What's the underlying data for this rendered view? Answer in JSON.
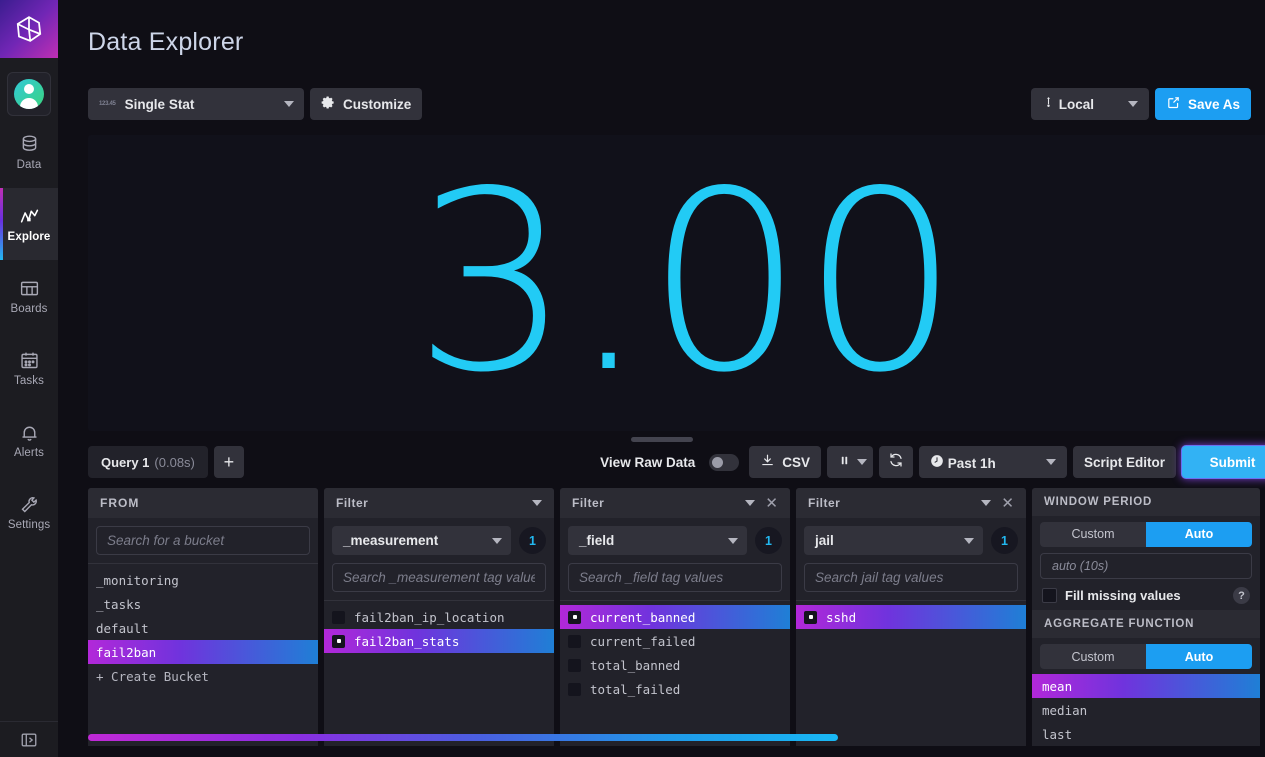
{
  "nav": {
    "logo_icon": "influxdb-logo-icon",
    "avatar_icon": "user-avatar-icon",
    "items": [
      {
        "label": "Data",
        "icon": "database-icon",
        "active": false
      },
      {
        "label": "Explore",
        "icon": "line-graph-icon",
        "active": true
      },
      {
        "label": "Boards",
        "icon": "dashboard-grid-icon",
        "active": false
      },
      {
        "label": "Tasks",
        "icon": "calendar-icon",
        "active": false
      },
      {
        "label": "Alerts",
        "icon": "bell-icon",
        "active": false
      },
      {
        "label": "Settings",
        "icon": "wrench-icon",
        "active": false
      }
    ],
    "collapse_icon": "sidebar-expand-icon"
  },
  "header": {
    "title": "Data Explorer"
  },
  "viz_bar": {
    "type_dropdown": {
      "label": "Single Stat",
      "icon": "single-stat-icon",
      "glyph": "123.45"
    },
    "customize": {
      "label": "Customize",
      "icon": "gear-icon"
    }
  },
  "header_right": {
    "timezone": {
      "label": "Local",
      "icon": "clock-pin-icon"
    },
    "save_as": {
      "label": "Save As",
      "icon": "export-icon"
    }
  },
  "graph": {
    "single_stat_value": "3.00",
    "color": "#22cbf5"
  },
  "query_bar": {
    "tab_label": "Query 1",
    "tab_duration": "(0.08s)",
    "add_query_label": "+",
    "view_raw_data_label": "View Raw Data",
    "view_raw_data_on": false,
    "csv_label": "CSV",
    "csv_icon": "download-icon",
    "pause_icon": "pause-icon",
    "refresh_icon": "refresh-icon",
    "time_range": {
      "label": "Past 1h",
      "icon": "clock-icon"
    },
    "script_editor_label": "Script Editor",
    "submit_label": "Submit"
  },
  "builder": {
    "from_panel": {
      "title": "FROM",
      "search_placeholder": "Search for a bucket",
      "search_value": "",
      "buckets": [
        {
          "name": "_monitoring",
          "selected": false
        },
        {
          "name": "_tasks",
          "selected": false
        },
        {
          "name": "default",
          "selected": false
        },
        {
          "name": "fail2ban",
          "selected": true
        }
      ],
      "create_bucket_label": "+ Create Bucket"
    },
    "filters": [
      {
        "title": "Filter",
        "closable": false,
        "tag_key": "_measurement",
        "count": "1",
        "search_placeholder": "Search _measurement tag values",
        "search_value": "",
        "values": [
          {
            "name": "fail2ban_ip_location",
            "selected": false
          },
          {
            "name": "fail2ban_stats",
            "selected": true
          }
        ]
      },
      {
        "title": "Filter",
        "closable": true,
        "tag_key": "_field",
        "count": "1",
        "search_placeholder": "Search _field tag values",
        "search_value": "",
        "values": [
          {
            "name": "current_banned",
            "selected": true
          },
          {
            "name": "current_failed",
            "selected": false
          },
          {
            "name": "total_banned",
            "selected": false
          },
          {
            "name": "total_failed",
            "selected": false
          }
        ]
      },
      {
        "title": "Filter",
        "closable": true,
        "tag_key": "jail",
        "count": "1",
        "search_placeholder": "Search jail tag values",
        "search_value": "",
        "values": [
          {
            "name": "sshd",
            "selected": true
          }
        ]
      }
    ],
    "window_period": {
      "title": "WINDOW PERIOD",
      "custom_label": "Custom",
      "auto_label": "Auto",
      "mode": "Auto",
      "value_placeholder": "auto (10s)",
      "fill_missing_label": "Fill missing values",
      "fill_missing_checked": false,
      "help_icon": "question-mark-icon"
    },
    "aggregate_function": {
      "title": "AGGREGATE FUNCTION",
      "custom_label": "Custom",
      "auto_label": "Auto",
      "mode": "Auto",
      "options": [
        {
          "name": "mean",
          "selected": true
        },
        {
          "name": "median",
          "selected": false
        },
        {
          "name": "last",
          "selected": false
        }
      ]
    }
  },
  "colors": {
    "accent_blue": "#1c9ef2",
    "gradient_start": "#b228d9",
    "gradient_end": "#1f7fd6",
    "stat_cyan": "#22cbf5"
  }
}
